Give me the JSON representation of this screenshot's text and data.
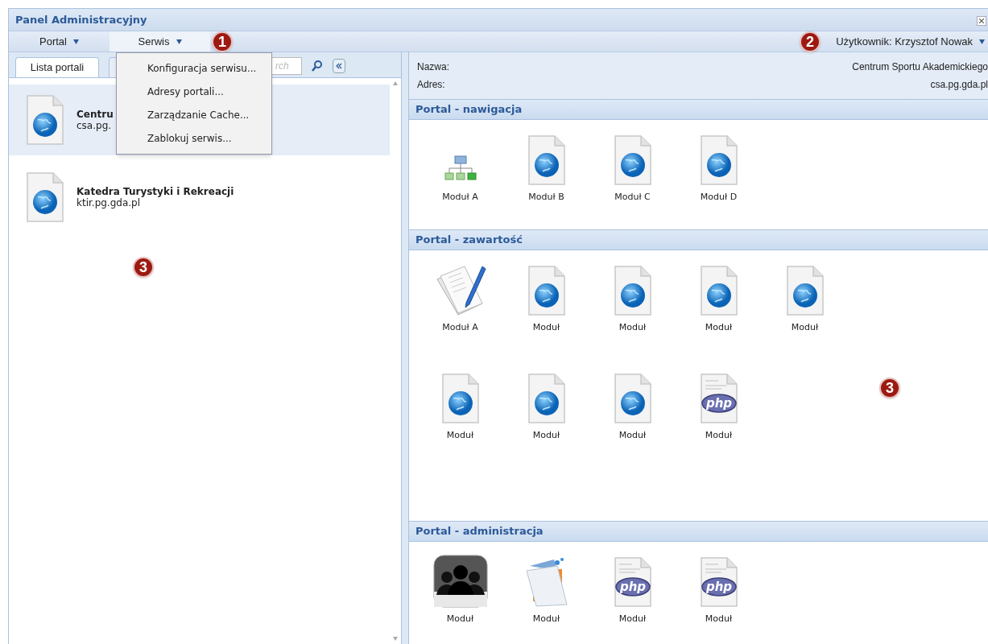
{
  "window": {
    "title": "Panel Administracyjny"
  },
  "menubar": {
    "menus": [
      {
        "label": "Portal",
        "open": false
      },
      {
        "label": "Serwis",
        "open": true
      }
    ],
    "callout": "1",
    "open_menu": {
      "items": [
        "Konfiguracja serwisu...",
        "Adresy portali...",
        "Zarządzanie Cache...",
        "Zablokuj serwis..."
      ]
    },
    "user": {
      "label": "Użytkownik: Krzysztof Nowak",
      "callout": "2"
    }
  },
  "left_panel": {
    "tabs": [
      {
        "label": "Lista portali",
        "selected": true
      },
      {
        "selected": false
      }
    ],
    "search": {
      "placeholder": "rch"
    },
    "callout": "3",
    "portals": [
      {
        "name": "Centru",
        "address": "csa.pg.",
        "selected": true
      },
      {
        "name": "Katedra Turystyki i Rekreacji",
        "address": "ktir.pg.gda.pl",
        "selected": false
      }
    ]
  },
  "details": [
    {
      "label": "Nazwa:",
      "value": "Centrum Sportu Akademickiego"
    },
    {
      "label": "Adres:",
      "value": "csa.pg.gda.pl"
    }
  ],
  "sections": [
    {
      "title": "Portal - nawigacja",
      "modules": [
        {
          "label": "Moduł A",
          "kind": "sitemap"
        },
        {
          "label": "Moduł B",
          "kind": "globe"
        },
        {
          "label": "Moduł C",
          "kind": "globe"
        },
        {
          "label": "Moduł D",
          "kind": "globe"
        }
      ]
    },
    {
      "title": "Portal - zawartość",
      "callout": "3",
      "modules": [
        {
          "label": "Moduł A",
          "kind": "notes"
        },
        {
          "label": "Moduł",
          "kind": "globe"
        },
        {
          "label": "Moduł",
          "kind": "globe"
        },
        {
          "label": "Moduł",
          "kind": "globe"
        },
        {
          "label": "Moduł",
          "kind": "globe"
        },
        {
          "label": "Moduł",
          "kind": "globe"
        },
        {
          "label": "Moduł",
          "kind": "globe"
        },
        {
          "label": "Moduł",
          "kind": "globe"
        },
        {
          "label": "Moduł",
          "kind": "php"
        }
      ]
    },
    {
      "title": "Portal - administracja",
      "modules": [
        {
          "label": "Moduł",
          "kind": "users"
        },
        {
          "label": "Moduł",
          "kind": "folder"
        },
        {
          "label": "Moduł",
          "kind": "php"
        },
        {
          "label": "Moduł",
          "kind": "php"
        }
      ]
    }
  ]
}
